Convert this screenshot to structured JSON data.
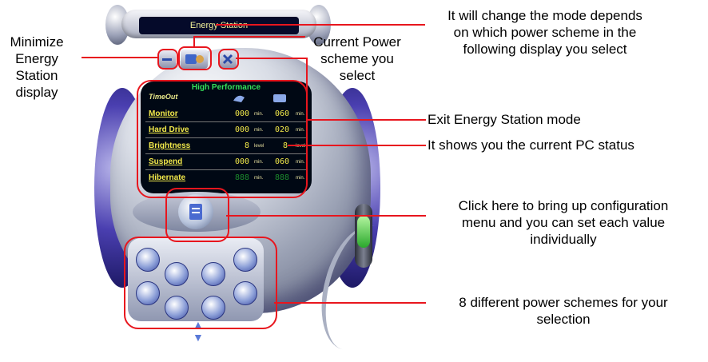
{
  "app": {
    "title": "Energy Station"
  },
  "display": {
    "scheme_name": "High Performance",
    "header": "TimeOut",
    "rows": [
      {
        "label": "Monitor",
        "v1": "000",
        "u1": "min.",
        "v2": "060",
        "u2": "min."
      },
      {
        "label": "Hard Drive",
        "v1": "000",
        "u1": "min.",
        "v2": "020",
        "u2": "min."
      },
      {
        "label": "Brightness",
        "v1": "8",
        "u1": "level",
        "v2": "8",
        "u2": "level"
      },
      {
        "label": "Suspend",
        "v1": "000",
        "u1": "min.",
        "v2": "060",
        "u2": "min."
      },
      {
        "label": "Hibernate",
        "v1": "888",
        "u1": "min.",
        "v2": "888",
        "u2": "min."
      }
    ]
  },
  "annotations": {
    "minimize_l1": "Minimize",
    "minimize_l2": "Energy",
    "minimize_l3": "Station",
    "minimize_l4": "display",
    "scheme_l1": "Current Power",
    "scheme_l2": "scheme you",
    "scheme_l3": "select",
    "mode_l1": "It will change the mode depends",
    "mode_l2": "on which power scheme in the",
    "mode_l3": "following display you select",
    "exit": "Exit Energy Station mode",
    "status": "It shows you the current PC status",
    "config_l1": "Click here to bring up configuration",
    "config_l2": "menu and you can set each value",
    "config_l3": "individually",
    "schemes_l1": "8 different power schemes for your",
    "schemes_l2": "selection"
  },
  "icons": [
    "minimize-icon",
    "power-scheme-icon",
    "close-icon",
    "configuration-icon",
    "scroll-arrow-icon"
  ],
  "colors": {
    "highlight": "#e8161e",
    "screen_text": "#f3ea4a",
    "scheme_title": "#35e05a"
  }
}
